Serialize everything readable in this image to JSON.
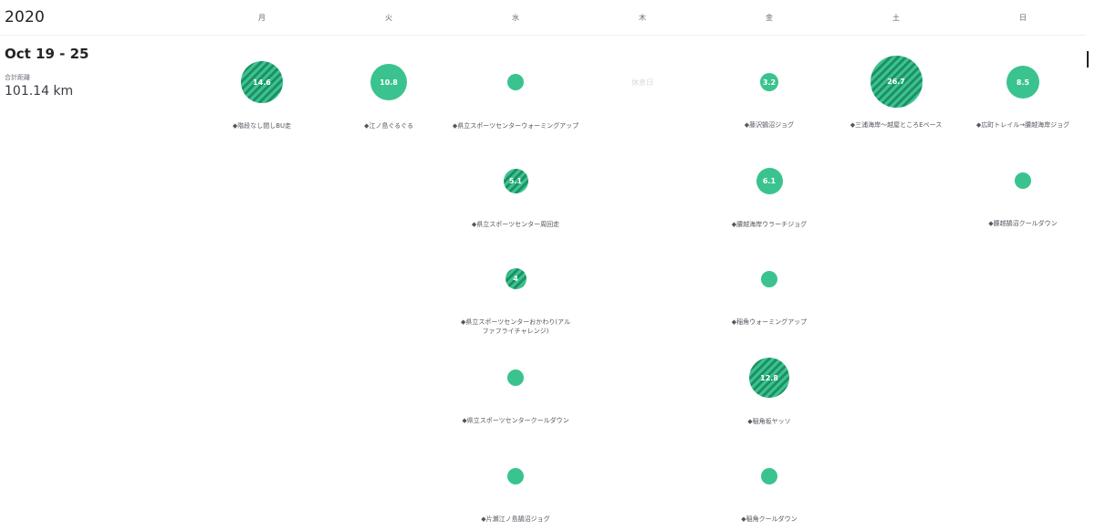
{
  "header": {
    "year": "2020",
    "days": [
      "月",
      "火",
      "水",
      "木",
      "金",
      "土",
      "日"
    ]
  },
  "week": {
    "range": "Oct 19 - 25",
    "distance_label": "合計距離",
    "distance_value": "101.14 km"
  },
  "rest_day_label": "休息日",
  "colors": {
    "bubble": "#3ac38f",
    "stripe": "#1f8e64"
  },
  "activities": {
    "mon": [
      {
        "distance": "14.6",
        "name": "◆階段なし間しBU走",
        "striped": true
      }
    ],
    "tue": [
      {
        "distance": "10.8",
        "name": "◆江ノ島ぐるぐる",
        "striped": false
      }
    ],
    "wed": [
      {
        "distance": "",
        "name": "◆県立スポーツセンターウォーミングアップ",
        "striped": false
      },
      {
        "distance": "5.1",
        "name": "◆県立スポーツセンター周回走",
        "striped": true
      },
      {
        "distance": "4",
        "name": "◆県立スポーツセンターおかわり(アルファフライチャレンジ)",
        "striped": true
      },
      {
        "distance": "",
        "name": "◆県立スポーツセンタークールダウン",
        "striped": false
      },
      {
        "distance": "",
        "name": "◆片瀬江ノ島鵠沼ジョグ",
        "striped": false
      }
    ],
    "fri": [
      {
        "distance": "3.2",
        "name": "◆藤沢鵠沼ジョグ",
        "striped": false
      },
      {
        "distance": "6.1",
        "name": "◆腰越海岸ウラーチジョグ",
        "striped": false
      },
      {
        "distance": "",
        "name": "◆稲角ウォーミングアップ",
        "striped": false
      },
      {
        "distance": "12.8",
        "name": "◆稲角坂ヤッソ",
        "striped": true
      },
      {
        "distance": "",
        "name": "◆稲角クールダウン",
        "striped": false
      }
    ],
    "sat": [
      {
        "distance": "26.7",
        "name": "◆三浦海岸～越屋ところEベース",
        "striped": true
      }
    ],
    "sun": [
      {
        "distance": "8.5",
        "name": "◆広町トレイル→腰越海岸ジョグ",
        "striped": false
      },
      {
        "distance": "",
        "name": "◆腰越鵠沼クールダウン",
        "striped": false
      }
    ]
  }
}
